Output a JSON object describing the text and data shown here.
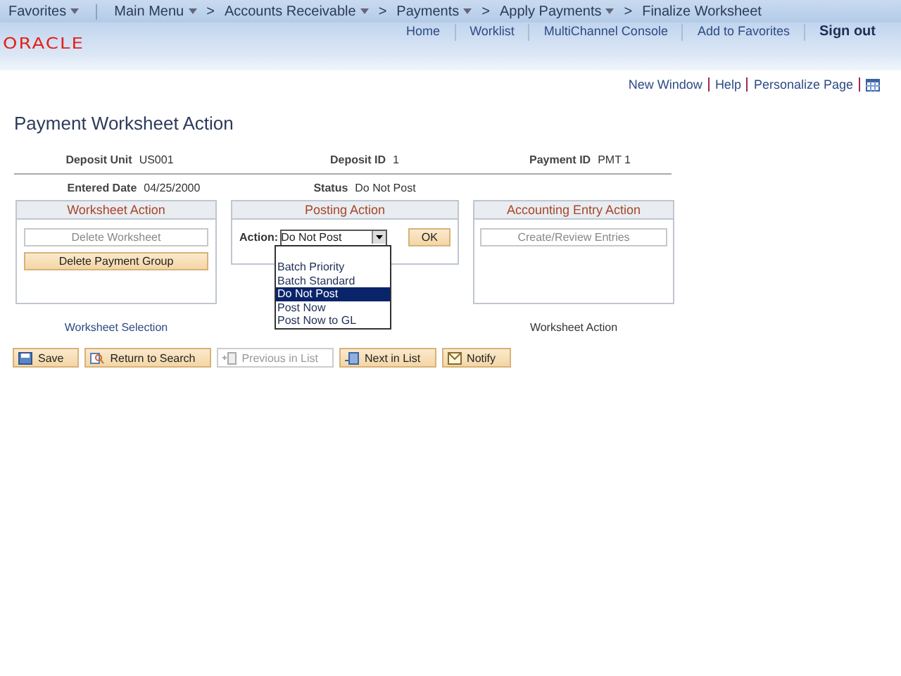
{
  "nav_bar": {
    "items": [
      {
        "label": "Favorites",
        "has_menu": true
      },
      {
        "label": "Main Menu",
        "has_menu": true
      },
      {
        "label": "Accounts Receivable",
        "has_menu": true
      },
      {
        "label": "Payments",
        "has_menu": true
      },
      {
        "label": "Apply Payments",
        "has_menu": true
      },
      {
        "label": "Finalize Worksheet",
        "has_menu": false
      }
    ],
    "separator": ">"
  },
  "header": {
    "logo": "ORACLE",
    "links": [
      {
        "label": "Home",
        "bold": false
      },
      {
        "label": "Worklist",
        "bold": false
      },
      {
        "label": "MultiChannel Console",
        "bold": false
      },
      {
        "label": "Add to Favorites",
        "bold": false
      },
      {
        "label": "Sign out",
        "bold": true
      }
    ]
  },
  "page_links": [
    "New Window",
    "Help",
    "Personalize Page"
  ],
  "title": "Payment Worksheet Action",
  "fields_row_1": [
    {
      "label": "Deposit Unit",
      "value": "US001"
    },
    {
      "label": "Deposit ID",
      "value": "1"
    },
    {
      "label": "Payment ID",
      "value": "PMT 1"
    }
  ],
  "fields_row_2": [
    {
      "label": "Entered Date",
      "value": "04/25/2000"
    },
    {
      "label": "Status",
      "value": "Do Not Post"
    }
  ],
  "worksheet_action": {
    "title": "Worksheet Action",
    "buttons": [
      {
        "label": "Delete Worksheet",
        "disabled": true
      },
      {
        "label": "Delete Payment Group",
        "disabled": false
      }
    ]
  },
  "posting_action": {
    "title": "Posting Action",
    "action_label": "Action:",
    "value": "Do Not Post",
    "ok": "OK",
    "dropdown": {
      "open": true,
      "options": [
        {
          "label": "Batch Priority",
          "selected": false
        },
        {
          "label": "Batch Standard",
          "selected": false
        },
        {
          "label": "Do Not Post",
          "selected": true
        },
        {
          "label": "Post Now",
          "selected": false
        },
        {
          "label": "Post Now to GL",
          "selected": false
        }
      ]
    }
  },
  "accounting_entry_action": {
    "title": "Accounting Entry Action",
    "buttons": [
      {
        "label": "Create/Review Entries",
        "disabled": true
      }
    ]
  },
  "bottom_links": [
    {
      "label": "Worksheet Selection",
      "link": true
    },
    {
      "label": "Worksheet Action",
      "link": false
    }
  ],
  "toolbar": [
    {
      "label": "Save",
      "kind": "save",
      "disabled": false
    },
    {
      "label": "Return to Search",
      "kind": "search",
      "disabled": false
    },
    {
      "label": "Previous in List",
      "kind": "prev",
      "disabled": true
    },
    {
      "label": "Next in List",
      "kind": "next",
      "disabled": false
    },
    {
      "label": "Notify",
      "kind": "notify",
      "disabled": false
    }
  ]
}
